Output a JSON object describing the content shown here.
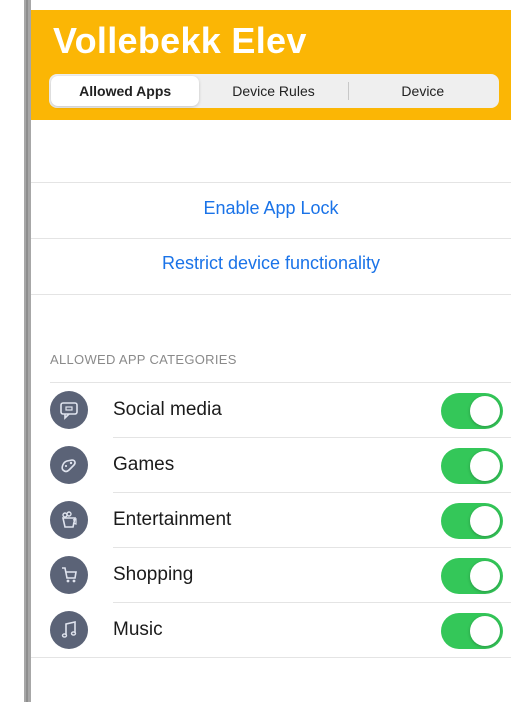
{
  "app": {
    "title": "Vollebekk Elev"
  },
  "tabs": [
    {
      "label": "Allowed Apps",
      "active": true
    },
    {
      "label": "Device Rules",
      "active": false
    },
    {
      "label": "Device",
      "active": false
    }
  ],
  "actions": {
    "enable_app_lock": "Enable App Lock",
    "restrict_device": "Restrict device functionality"
  },
  "categories": {
    "header": "ALLOWED APP CATEGORIES",
    "items": [
      {
        "label": "Social media",
        "icon": "chat-bubble-icon",
        "enabled": true
      },
      {
        "label": "Games",
        "icon": "game-controller-icon",
        "enabled": true
      },
      {
        "label": "Entertainment",
        "icon": "popcorn-icon",
        "enabled": true
      },
      {
        "label": "Shopping",
        "icon": "shopping-cart-icon",
        "enabled": true
      },
      {
        "label": "Music",
        "icon": "music-note-icon",
        "enabled": true
      }
    ]
  },
  "colors": {
    "header": "#fbb605",
    "link": "#1a73e8",
    "toggle_on": "#34c759",
    "icon_bg": "#5b6377"
  }
}
